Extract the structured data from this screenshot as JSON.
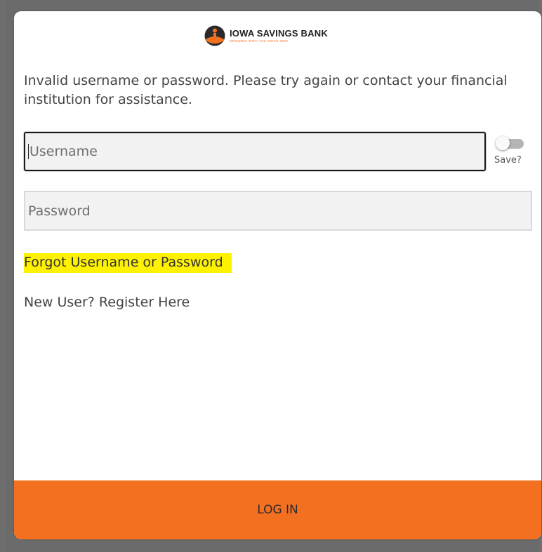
{
  "brand": {
    "name": "IOWA SAVINGS BANK",
    "tagline": "GROWING WITH YOU SINCE 1902",
    "accent_color": "#f37021",
    "logo_icon": "iowa-savings-bank-logo-icon"
  },
  "login_form": {
    "error_message": "Invalid username or password. Please try again or contact your financial institution for assistance.",
    "username_placeholder": "Username",
    "username_value": "",
    "password_placeholder": "Password",
    "password_value": "",
    "save_toggle": {
      "label": "Save?",
      "on": false
    },
    "forgot_link": "Forgot Username or Password",
    "register_link": "New User? Register Here",
    "login_button": "LOG IN"
  }
}
